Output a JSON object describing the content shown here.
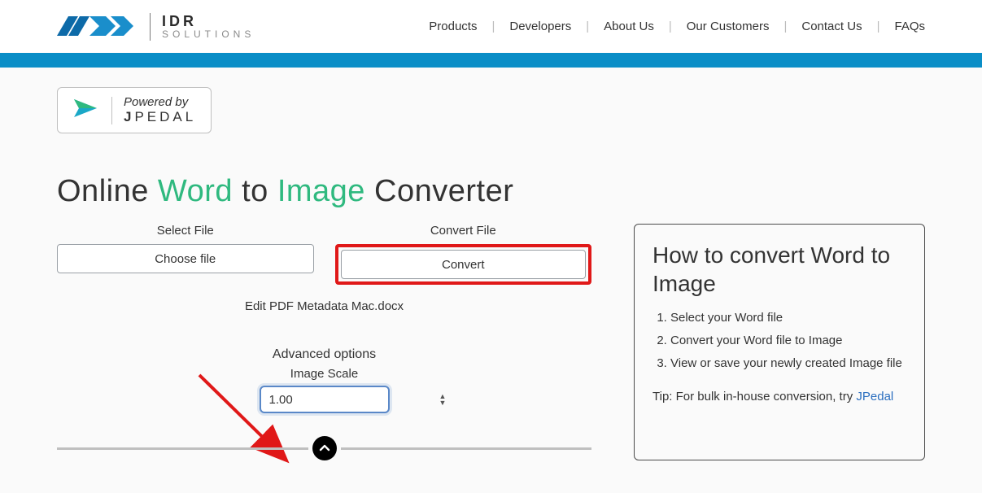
{
  "brand": {
    "line1": "IDR",
    "line2": "SOLUTIONS"
  },
  "nav": {
    "products": "Products",
    "developers": "Developers",
    "about": "About Us",
    "customers": "Our Customers",
    "contact": "Contact Us",
    "faqs": "FAQs"
  },
  "powered": {
    "line1": "Powered by",
    "prefix": "J",
    "rest": "PEDAL"
  },
  "title": {
    "p1": "Online ",
    "w1": "Word",
    "p2": " to ",
    "w2": "Image",
    "p3": " Converter"
  },
  "labels": {
    "select_file": "Select File",
    "convert_file": "Convert File",
    "choose_file": "Choose file",
    "convert": "Convert",
    "advanced": "Advanced options",
    "image_scale": "Image Scale"
  },
  "selected_filename": "Edit PDF Metadata Mac.docx",
  "image_scale_value": "1.00",
  "side": {
    "title": "How to convert Word to Image",
    "steps": [
      "Select your Word file",
      "Convert your Word file to Image",
      "View or save your newly created Image file"
    ],
    "tip_prefix": "Tip: For bulk in-house conversion, try ",
    "tip_link": "JPedal"
  }
}
